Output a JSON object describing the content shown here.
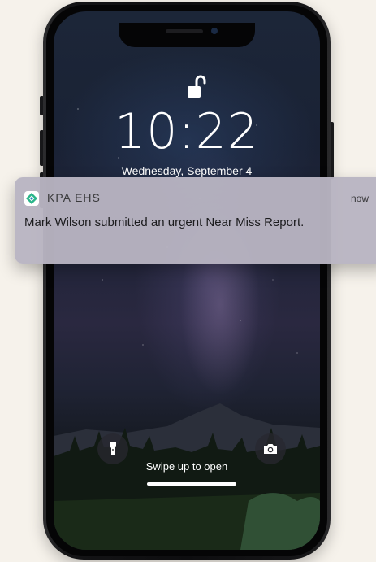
{
  "lock_screen": {
    "time": "10:22",
    "date": "Wednesday, September 4",
    "swipe_hint": "Swipe up to open",
    "lock_state_icon": "unlocked-padlock-icon"
  },
  "notification": {
    "app_name": "KPA EHS",
    "timestamp": "now",
    "message": "Mark Wilson submitted an urgent Near Miss Report.",
    "app_icon": "kpa-ehs-logo-icon",
    "accent_color": "#2bb58a"
  },
  "quick_actions": {
    "left_icon": "flashlight-icon",
    "right_icon": "camera-icon"
  },
  "colors": {
    "page_background": "#f6f2eb",
    "phone_body": "#0d0d0f",
    "notification_background": "#b8b4c2"
  }
}
